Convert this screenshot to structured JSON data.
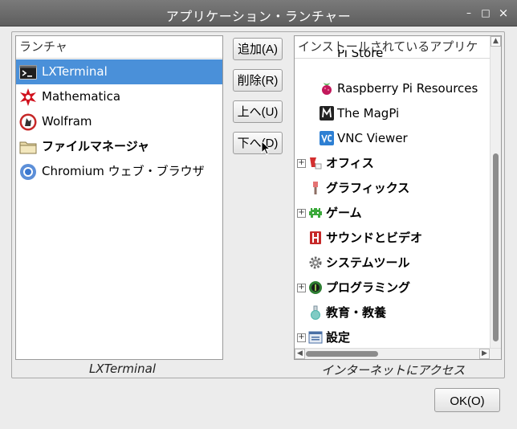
{
  "window": {
    "title": "アプリケーション・ランチャー",
    "minimize_glyph": "–",
    "maximize_glyph": "□",
    "close_glyph": "×"
  },
  "launcher": {
    "header": "ランチャ",
    "items": [
      {
        "label": "LXTerminal",
        "icon": "terminal-icon",
        "selected": true
      },
      {
        "label": "Mathematica",
        "icon": "mathematica-icon"
      },
      {
        "label": "Wolfram",
        "icon": "wolfram-icon"
      },
      {
        "label": "ファイルマネージャ",
        "icon": "folder-icon"
      },
      {
        "label": "Chromium ウェブ・ブラウザ",
        "icon": "chromium-icon"
      }
    ],
    "caption": "LXTerminal"
  },
  "buttons": {
    "add": "追加(A)",
    "remove": "削除(R)",
    "up": "上へ(U)",
    "down": "下へ(D)"
  },
  "installed": {
    "header": "インストールされているアプリケ",
    "items": [
      {
        "label": "Pi Store",
        "icon": "",
        "level": 2
      },
      {
        "label": "Raspberry Pi Resources",
        "icon": "raspberry-icon",
        "level": 2
      },
      {
        "label": "The MagPi",
        "icon": "magpi-icon",
        "level": 2
      },
      {
        "label": "VNC Viewer",
        "icon": "vnc-icon",
        "level": 2
      },
      {
        "label": "オフィス",
        "icon": "office-icon",
        "level": 1,
        "expander": "+"
      },
      {
        "label": "グラフィックス",
        "icon": "graphics-icon",
        "level": 1
      },
      {
        "label": "ゲーム",
        "icon": "game-icon",
        "level": 1,
        "expander": "+"
      },
      {
        "label": "サウンドとビデオ",
        "icon": "sound-video-icon",
        "level": 1
      },
      {
        "label": "システムツール",
        "icon": "gear-icon",
        "level": 1
      },
      {
        "label": "プログラミング",
        "icon": "programming-icon",
        "level": 1,
        "expander": "+"
      },
      {
        "label": "教育・教養",
        "icon": "education-icon",
        "level": 1
      },
      {
        "label": "設定",
        "icon": "settings-icon",
        "level": 1,
        "expander": "+"
      }
    ],
    "caption": "インターネットにアクセス"
  },
  "ok_button": "OK(O)"
}
